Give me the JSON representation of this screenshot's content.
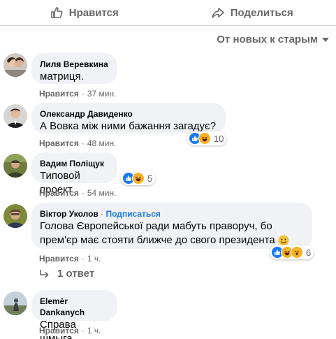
{
  "actions": {
    "like_label": "Нравится",
    "share_label": "Поделиться"
  },
  "sort": {
    "label": "От новых к старым"
  },
  "comments": [
    {
      "author": "Лиля Веревкина",
      "text": "матриця.",
      "like": "Нравится",
      "time": "37 мин."
    },
    {
      "author": "Олександр Давиденко",
      "text": "А Вовка між ними бажання загадує?",
      "like": "Нравится",
      "time": "48 мин.",
      "reactions_count": "10"
    },
    {
      "author": "Вадим Поліщук",
      "text": "Типовой проект",
      "like": "Нравится",
      "time": "54 мин.",
      "reactions_count": "5"
    },
    {
      "author": "Віктор Уколов",
      "follow": "Подписаться",
      "text_line1": "Голова Європейської ради мабуть праворуч, бо",
      "text_line2": "прем'єр має стояти ближче до свого президента",
      "like": "Нравится",
      "time": "1 ч.",
      "reactions_count": "6"
    },
    {
      "author": "Elemèr Dankanych",
      "text": "Справа шмыга",
      "like": "Нравится",
      "time": "1 ч."
    }
  ],
  "replies": {
    "label": "1 ответ"
  }
}
